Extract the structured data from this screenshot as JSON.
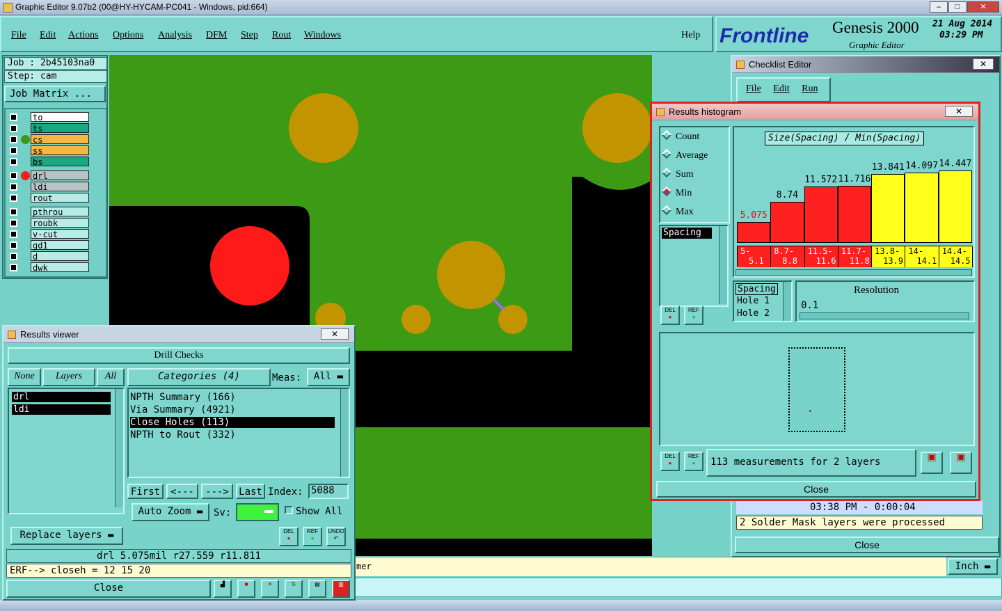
{
  "window": {
    "title": "Graphic Editor 9.07b2 (00@HY-HYCAM-PC041 - Windows, pid:664)"
  },
  "menu": {
    "items": [
      "File",
      "Edit",
      "Actions",
      "Options",
      "Analysis",
      "DFM",
      "Step",
      "Rout",
      "Windows"
    ],
    "help": "Help"
  },
  "brand": {
    "logo": "Frontline",
    "product": "Genesis 2000",
    "subtitle": "Graphic Editor",
    "date": "21 Aug 2014",
    "time": "03:29 PM"
  },
  "job": {
    "job_label": "Job : 2b45103na0",
    "step_label": "Step: cam",
    "matrix_button": "Job Matrix ..."
  },
  "layers": [
    {
      "name": "to",
      "color": "#ffffff",
      "dot": ""
    },
    {
      "name": "ts",
      "color": "#1aa882",
      "dot": ""
    },
    {
      "name": "cs",
      "color": "#f5b642",
      "dot": "#3d9a14"
    },
    {
      "name": "ss",
      "color": "#f5b642",
      "dot": ""
    },
    {
      "name": "bs",
      "color": "#1aa882",
      "dot": ""
    },
    {
      "name": "drl",
      "color": "#b8c4c4",
      "dot": "#ff1a1a"
    },
    {
      "name": "ldi",
      "color": "#b8c4c4",
      "dot": ""
    },
    {
      "name": "rout",
      "color": "#b8ece6",
      "dot": ""
    },
    {
      "name": "pthrou",
      "color": "#b8ece6",
      "dot": ""
    },
    {
      "name": "roubk",
      "color": "#b8ece6",
      "dot": ""
    },
    {
      "name": "v-cut",
      "color": "#b8ece6",
      "dot": ""
    },
    {
      "name": "gd1",
      "color": "#b8ece6",
      "dot": ""
    },
    {
      "name": "d",
      "color": "#b8ece6",
      "dot": ""
    },
    {
      "name": "dwk",
      "color": "#b8ece6",
      "dot": ""
    }
  ],
  "results_viewer": {
    "title": "Results viewer",
    "header": "Drill Checks",
    "none_btn": "None",
    "layers_btn": "Layers",
    "all_btn": "All",
    "categories_btn": "Categories (4)",
    "meas_label": "Meas:",
    "meas_value": "All",
    "layer_list": [
      "drl",
      "ldi"
    ],
    "categories": [
      "NPTH Summary (166)",
      "Via Summary (4921)",
      "Close Holes (113)",
      "NPTH to Rout (332)"
    ],
    "first": "First",
    "prev": "<---",
    "next": "--->",
    "last": "Last",
    "index_label": "Index:",
    "index_value": "5088",
    "auto_zoom": "Auto Zoom",
    "sv_label": "Sv:",
    "show_all": "Show All",
    "replace_layers": "Replace layers",
    "status": "drl  5.075mil  r27.559  r11.811",
    "erf": "ERF--> closeh = 12 15 20",
    "close": "Close",
    "del": "DEL",
    "ref": "REF",
    "undo": "UNDO"
  },
  "histogram": {
    "title": "Results histogram",
    "chart_title": "Size(Spacing) / Min(Spacing)",
    "modes": [
      "Count",
      "Average",
      "Sum",
      "Min",
      "Max"
    ],
    "selected_mode": "Min",
    "list_item": "Spacing",
    "attr_list": [
      "Spacing",
      "Hole 1",
      "Hole 2"
    ],
    "resolution_label": "Resolution",
    "resolution_value": "0.1",
    "summary": "113 measurements for 2 layers",
    "close": "Close",
    "del": "DEL",
    "ref": "REF"
  },
  "chart_data": {
    "type": "bar",
    "title": "Size(Spacing) / Min(Spacing)",
    "categories": [
      "5-5.1",
      "8.7-8.8",
      "11.5-11.6",
      "11.7-11.8",
      "13.8-13.9",
      "14-14.1",
      "14.4-14.5"
    ],
    "bin_labels_top": [
      "5-",
      "8.7-",
      "11.5-",
      "11.7-",
      "13.8-",
      "14-",
      "14.4-"
    ],
    "bin_labels_bottom": [
      "5.1",
      "8.8",
      "11.6",
      "11.8",
      "13.9",
      "14.1",
      "14.5"
    ],
    "values": [
      5.075,
      8.74,
      11.572,
      11.716,
      13.841,
      14.097,
      14.447
    ],
    "value_labels": [
      "5.075",
      "8.74",
      "11.572",
      "11.716",
      "13.841",
      "14.097",
      "14.447"
    ],
    "colors": [
      "#ff2020",
      "#ff2020",
      "#ff2020",
      "#ff2020",
      "#ffff1a",
      "#ffff1a",
      "#ffff1a"
    ],
    "ylim": [
      0,
      14.447
    ]
  },
  "checklist": {
    "title": "Checklist Editor",
    "menu": [
      "File",
      "Edit",
      "Run"
    ],
    "time_row": "03:38 PM - 0:00:04",
    "message": "2 Solder Mask layers were processed",
    "close": "Close"
  },
  "bottom": {
    "partial_text": "mer",
    "units": "Inch"
  }
}
